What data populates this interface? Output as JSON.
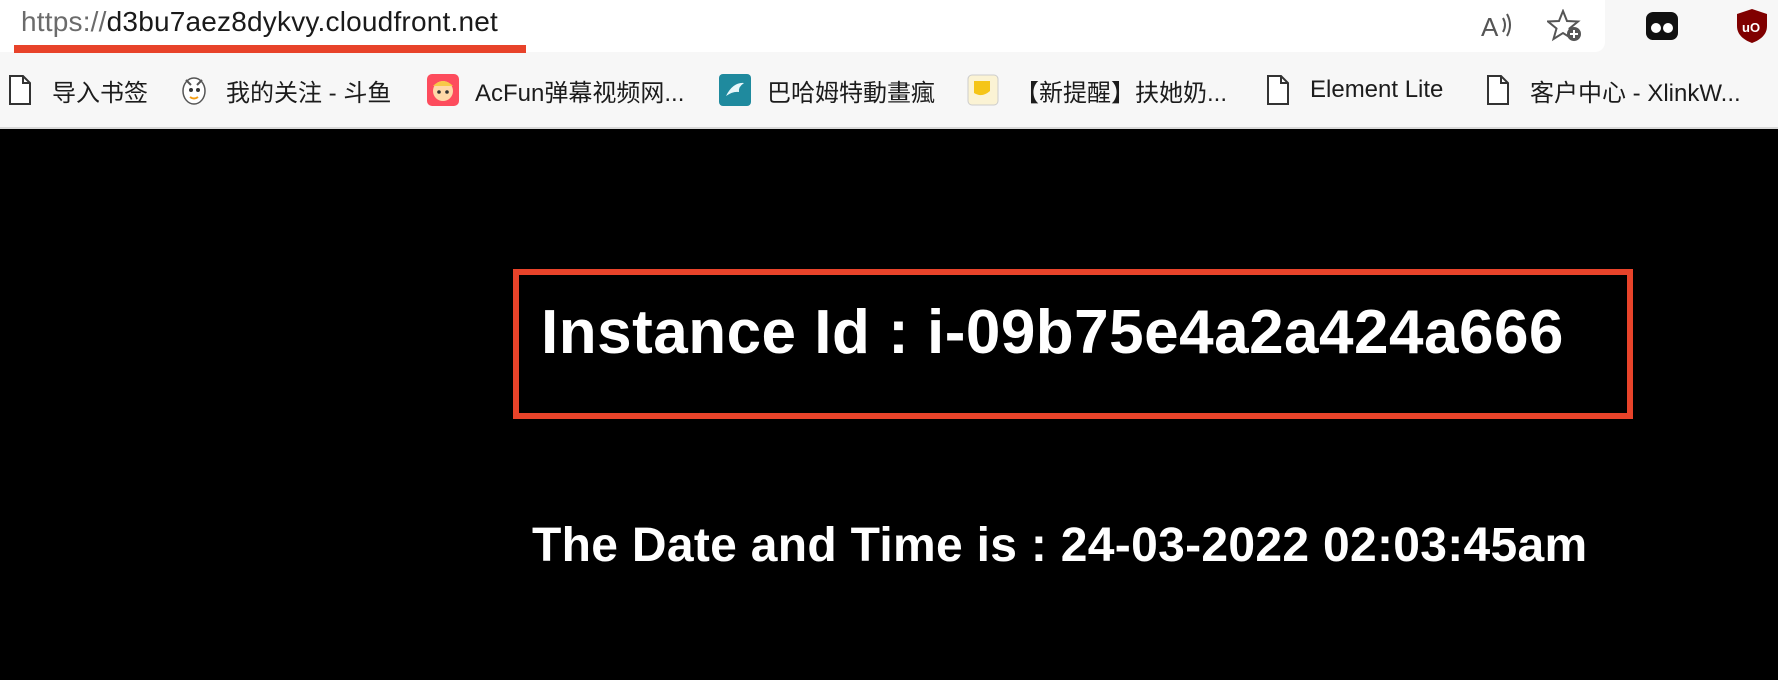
{
  "browser": {
    "url_scheme": "https://",
    "url_host": "d3bu7aez8dykvy.cloudfront.net",
    "toolbar_icons": [
      "read-aloud-icon",
      "add-favorite-icon",
      "extension-glasses-icon",
      "ublock-origin-icon"
    ]
  },
  "bookmarks": [
    {
      "label": "导入书签",
      "icon": "document-icon"
    },
    {
      "label": "我的关注 - 斗鱼",
      "icon": "douyu-icon"
    },
    {
      "label": "AcFun弹幕视频网...",
      "icon": "acfun-icon"
    },
    {
      "label": "巴哈姆特動畫瘋",
      "icon": "bahamut-icon"
    },
    {
      "label": "【新提醒】扶她奶...",
      "icon": "forum-icon"
    },
    {
      "label": "Element Lite",
      "icon": "document-icon"
    },
    {
      "label": "客户中心 - XlinkW...",
      "icon": "document-icon"
    }
  ],
  "page": {
    "instance_id": "Instance Id : i-09b75e4a2a424a666",
    "datetime": "The Date and Time is : 24-03-2022 02:03:45am"
  },
  "colors": {
    "highlight": "#e8432a",
    "page_background": "#000000",
    "page_text": "#ffffff"
  }
}
